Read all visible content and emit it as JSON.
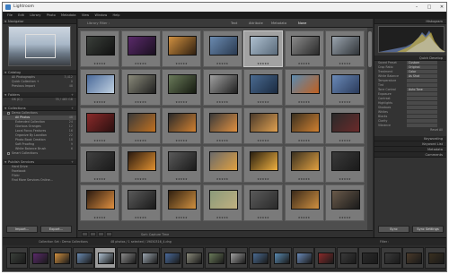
{
  "window": {
    "title": "Lightroom"
  },
  "window_buttons": [
    "–",
    "□",
    "✕"
  ],
  "menu": [
    "File",
    "Edit",
    "Library",
    "Photo",
    "Metadata",
    "View",
    "Window",
    "Help"
  ],
  "left_panel": {
    "navigator": {
      "title": "Navigator",
      "zoom": "FIT  FILL  1:1  3:1"
    },
    "catalog": {
      "title": "Catalog",
      "items": [
        {
          "label": "All Photographs",
          "count": "3,412"
        },
        {
          "label": "Quick Collection +",
          "count": "0"
        },
        {
          "label": "Previous Import",
          "count": "48"
        }
      ]
    },
    "folders": {
      "title": "Folders",
      "volume": "OS (C:)",
      "space": "78 / 465 GB"
    },
    "collections": {
      "title": "Collections",
      "items": [
        {
          "label": "Demo Collections",
          "count": ""
        },
        {
          "label": "All Photos",
          "count": "48"
        },
        {
          "label": "Extended Collection",
          "count": "24"
        },
        {
          "label": "Glorious Oranges",
          "count": "12"
        },
        {
          "label": "Local Focus Features",
          "count": "16"
        },
        {
          "label": "Organize By Location",
          "count": "22"
        },
        {
          "label": "Photo Book Creation",
          "count": "18"
        },
        {
          "label": "Soft Proofing",
          "count": "9"
        },
        {
          "label": "White Balance Brush",
          "count": "6"
        },
        {
          "label": "Smart Collections",
          "count": ""
        }
      ]
    },
    "publish": {
      "title": "Publish Services",
      "items": [
        "Hard Drive",
        "Facebook",
        "Flickr",
        "Find More Services Online..."
      ]
    },
    "buttons": {
      "import": "Import...",
      "export": "Export..."
    }
  },
  "library_filter": {
    "label": "Library Filter :",
    "options": [
      "Text",
      "Attribute",
      "Metadata",
      "None"
    ],
    "active": "None"
  },
  "grid_thumbs": [
    {
      "a": "#3a3f3a",
      "b": "#111",
      "sel": false
    },
    {
      "a": "#5a2a6a",
      "b": "#1a1020",
      "sel": false
    },
    {
      "a": "#d09040",
      "b": "#302010",
      "sel": false
    },
    {
      "a": "#6a8ab0",
      "b": "#2a3a50",
      "sel": false
    },
    {
      "a": "#aec0d0",
      "b": "#5a6a7a",
      "sel": true
    },
    {
      "a": "#8a8a8a",
      "b": "#2a2a2a",
      "sel": false
    },
    {
      "a": "#9aa4ae",
      "b": "#303438",
      "sel": false
    },
    {
      "a": "#4a6a9a",
      "b": "#c0d0e0",
      "sel": false
    },
    {
      "a": "#8a8a7a",
      "b": "#202020",
      "sel": false
    },
    {
      "a": "#6a7a5a",
      "b": "#151a10",
      "sel": false
    },
    {
      "a": "#a0a0a0",
      "b": "#202020",
      "sel": false
    },
    {
      "a": "#4a6a90",
      "b": "#1a2a40",
      "sel": false
    },
    {
      "a": "#5a8ab0",
      "b": "#c06020",
      "sel": false
    },
    {
      "a": "#6a8ab8",
      "b": "#2a3a5a",
      "sel": false
    },
    {
      "a": "#8a2a2a",
      "b": "#2a1010",
      "sel": false
    },
    {
      "a": "#3a3a3a",
      "b": "#c07020",
      "sel": false
    },
    {
      "a": "#2a2a2a",
      "b": "#d08030",
      "sel": false
    },
    {
      "a": "#3a3a3a",
      "b": "#e09040",
      "sel": false
    },
    {
      "a": "#4a3a2a",
      "b": "#e0a050",
      "sel": false
    },
    {
      "a": "#3a3020",
      "b": "#d08030",
      "sel": false
    },
    {
      "a": "#2a2a2a",
      "b": "#6a2a2a",
      "sel": false
    },
    {
      "a": "#404040",
      "b": "#1a1a1a",
      "sel": false
    },
    {
      "a": "#2a1a10",
      "b": "#e09030",
      "sel": false
    },
    {
      "a": "#5a5a5a",
      "b": "#1a1a1a",
      "sel": false
    },
    {
      "a": "#6a6a6a",
      "b": "#e0a040",
      "sel": false
    },
    {
      "a": "#2a2010",
      "b": "#f0b040",
      "sel": false
    },
    {
      "a": "#3a3020",
      "b": "#e0a040",
      "sel": false
    },
    {
      "a": "#3a3a3a",
      "b": "#1a1a1a",
      "sel": false
    },
    {
      "a": "#2a1a10",
      "b": "#e09040",
      "sel": false
    },
    {
      "a": "#5a5a5a",
      "b": "#1a1a1a",
      "sel": false
    },
    {
      "a": "#302010",
      "b": "#d09040",
      "sel": false
    },
    {
      "a": "#8a9a7a",
      "b": "#c0b080",
      "sel": false
    },
    {
      "a": "#5a5a5a",
      "b": "#2a2a2a",
      "sel": false
    },
    {
      "a": "#3a2a1a",
      "b": "#d09040",
      "sel": false
    },
    {
      "a": "#6a5a4a",
      "b": "#1a1a1a",
      "sel": false
    }
  ],
  "stars": "★★★★★",
  "toolbar": {
    "sort_label": "Sort: Capture Time"
  },
  "right_panel": {
    "histogram_title": "Histogram",
    "quick_develop": {
      "title": "Quick Develop",
      "rows": [
        {
          "label": "Saved Preset",
          "value": "Custom"
        },
        {
          "label": "Crop Ratio",
          "value": "Original"
        },
        {
          "label": "Treatment",
          "value": "Color"
        },
        {
          "label": "White Balance",
          "value": "As Shot"
        },
        {
          "label": "Temperature",
          "value": ""
        },
        {
          "label": "Tint",
          "value": ""
        },
        {
          "label": "Tone Control",
          "value": "Auto Tone"
        },
        {
          "label": "Exposure",
          "value": ""
        },
        {
          "label": "Contrast",
          "value": ""
        },
        {
          "label": "Highlights",
          "value": ""
        },
        {
          "label": "Shadows",
          "value": ""
        },
        {
          "label": "Whites",
          "value": ""
        },
        {
          "label": "Blacks",
          "value": ""
        },
        {
          "label": "Clarity",
          "value": ""
        },
        {
          "label": "Vibrance",
          "value": ""
        }
      ],
      "reset": "Reset All"
    },
    "sections": [
      "Keywording",
      "Keyword List",
      "Metadata",
      "Comments"
    ],
    "buttons": {
      "sync": "Sync",
      "sync_settings": "Sync Settings"
    }
  },
  "filmstrip_bar": {
    "collection": "Collection Set : Demo Collections",
    "summary": "48 photos / 1 selected / 19050316_4.dng",
    "filter_label": "Filter :"
  },
  "filmstrip_thumbs": [
    "#3a3f3a",
    "#5a2a6a",
    "#d09040",
    "#6a8ab0",
    "#aec0d0",
    "#8a8a8a",
    "#9aa4ae",
    "#4a6a9a",
    "#8a8a7a",
    "#6a7a5a",
    "#a0a0a0",
    "#4a6a90",
    "#5a8ab0",
    "#6a8ab8",
    "#8a2a2a",
    "#3a3a3a",
    "#2a2a2a",
    "#3a3a3a",
    "#4a3a2a",
    "#3a3020"
  ]
}
